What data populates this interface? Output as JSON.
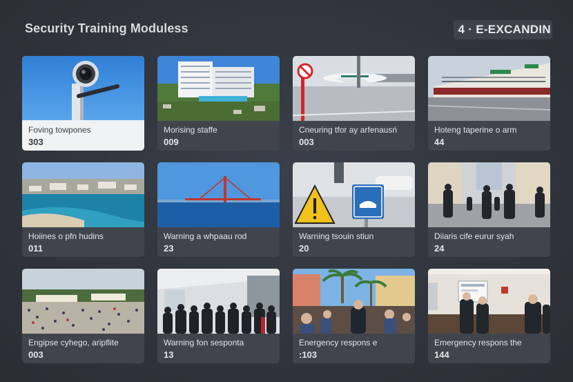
{
  "header": {
    "title": "Security Training Moduless",
    "module_count": "4 · E-EXCANDIN"
  },
  "cards": [
    {
      "title": "Foving towpones",
      "count": "303",
      "image": "security-camera-photo"
    },
    {
      "title": "Morising staffe",
      "count": "009",
      "image": "hotel-building-photo"
    },
    {
      "title": "Cneuring tfor ay arfenausń",
      "count": "003",
      "image": "airport-tarmac-photo"
    },
    {
      "title": "Hoteng taperine o arm",
      "count": "44",
      "image": "terminal-building-photo"
    },
    {
      "title": "Hoiines o pfn hudins",
      "count": "011",
      "image": "coastal-bay-photo"
    },
    {
      "title": "Warning a whpaau rod",
      "count": "23",
      "image": "bridge-over-sea-photo"
    },
    {
      "title": "Warning tsouin stiun",
      "count": "20",
      "image": "warning-signs-photo"
    },
    {
      "title": "Diiaris cife eurur syah",
      "count": "24",
      "image": "pedestrian-street-photo"
    },
    {
      "title": "Engipse  cyhego, aripflite",
      "count": "003",
      "image": "crowded-plaza-photo"
    },
    {
      "title": "Warning fon sesponta",
      "count": "13",
      "image": "terminal-crowd-photo"
    },
    {
      "title": "Energency respons  e",
      "count": ":103",
      "image": "emergency-crowd-photo"
    },
    {
      "title": "Emergency respons  the",
      "count": "144",
      "image": "briefing-room-photo"
    }
  ]
}
